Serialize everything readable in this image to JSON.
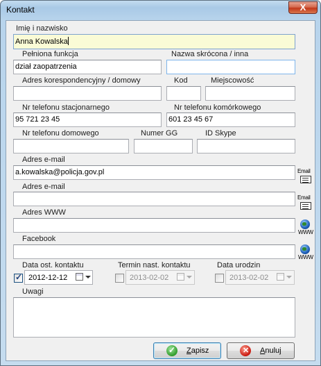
{
  "window": {
    "title": "Kontakt",
    "close_label": "X"
  },
  "form": {
    "name_label": "Imię i nazwisko",
    "name_value": "Anna Kowalska",
    "function_label": "Pełniona funkcja",
    "function_value": "dział zaopatrzenia",
    "short_name_label": "Nazwa skrócona / inna",
    "short_name_value": "",
    "address_label": "Adres korespondencyjny / domowy",
    "address_value": "",
    "postcode_label": "Kod",
    "postcode_value": "",
    "city_label": "Miejscowość",
    "city_value": "",
    "phone_label": "Nr telefonu stacjonarnego",
    "phone_value": "95 721 23 45",
    "mobile_label": "Nr telefonu komórkowego",
    "mobile_value": "601 23 45 67",
    "home_phone_label": "Nr telefonu domowego",
    "home_phone_value": "",
    "gg_label": "Numer GG",
    "gg_value": "",
    "skype_label": "ID Skype",
    "skype_value": "",
    "email1_label": "Adres e-mail",
    "email1_value": "a.kowalska@policja.gov.pl",
    "email2_label": "Adres e-mail",
    "email2_value": "",
    "www_label": "Adres WWW",
    "www_value": "",
    "facebook_label": "Facebook",
    "facebook_value": "",
    "last_contact_label": "Data ost. kontaktu",
    "last_contact_value": "2012-12-12",
    "last_contact_checked": true,
    "next_contact_label": "Termin nast. kontaktu",
    "next_contact_value": "2013-02-02",
    "next_contact_checked": false,
    "birthday_label": "Data urodzin",
    "birthday_value": "2013-02-02",
    "birthday_checked": false,
    "notes_label": "Uwagi",
    "notes_value": ""
  },
  "icons": {
    "email_text": "Email",
    "www_text": "WWW"
  },
  "buttons": {
    "save_pre": "",
    "save_mnemonic": "Z",
    "save_rest": "apisz",
    "cancel_mnemonic": "A",
    "cancel_rest": "nuluj"
  },
  "colors": {
    "focus_field": "#fafbd6",
    "save_accent": "#2f9b2b",
    "cancel_accent": "#c8180e"
  }
}
